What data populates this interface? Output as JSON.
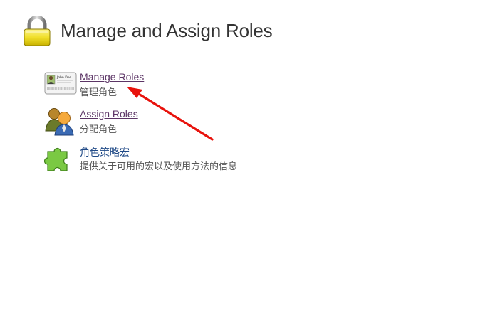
{
  "header": {
    "title": "Manage and Assign Roles",
    "icon": "lock-icon"
  },
  "items": [
    {
      "label": "Manage Roles",
      "description": "管理角色",
      "icon": "id-card-icon"
    },
    {
      "label": "Assign Roles",
      "description": "分配角色",
      "icon": "users-icon"
    },
    {
      "label": "角色策略宏",
      "description": "提供关于可用的宏以及使用方法的信息",
      "icon": "puzzle-piece-icon"
    }
  ],
  "id_card": {
    "name": "John Doe"
  },
  "annotation": {
    "color": "#e8120c"
  }
}
